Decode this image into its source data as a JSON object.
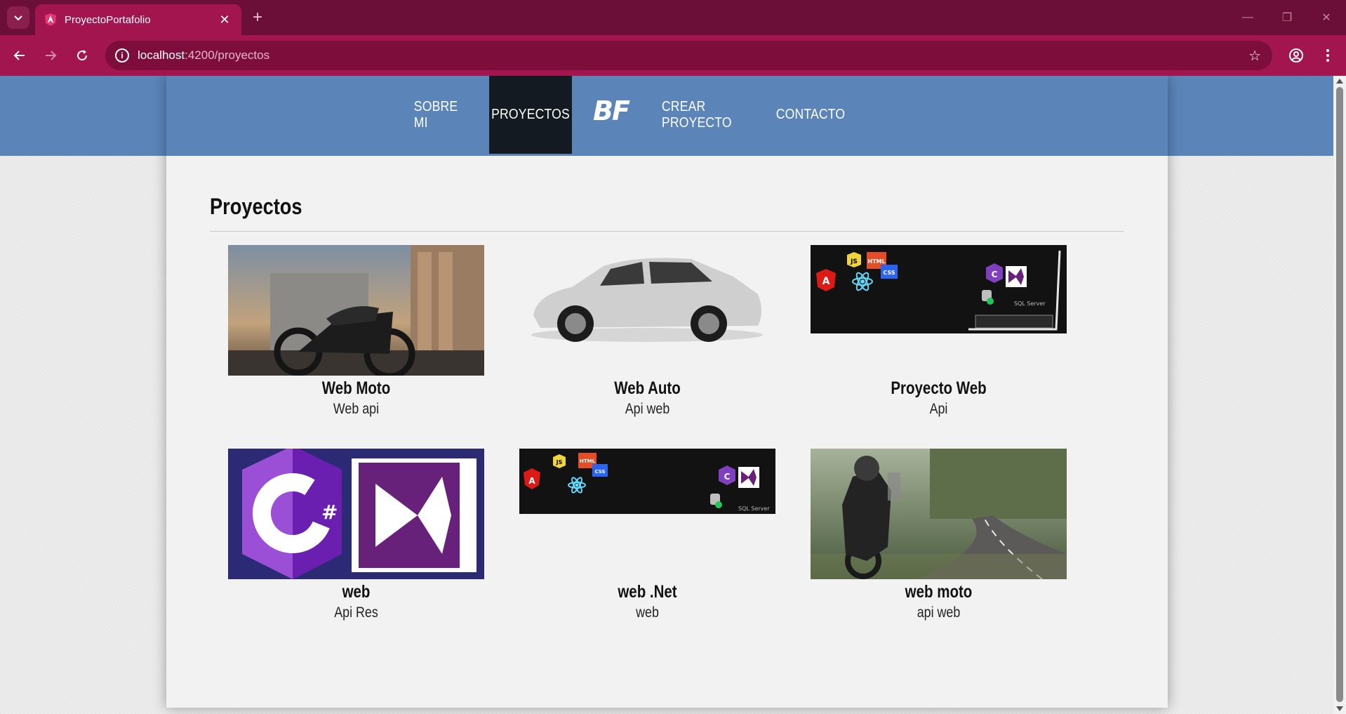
{
  "browser": {
    "tab_title": "ProyectoPortafolio",
    "url_host": "localhost",
    "url_path": ":4200/proyectos"
  },
  "nav": {
    "items": [
      {
        "label": "SOBRE MI",
        "active": false
      },
      {
        "label": "PROYECTOS",
        "active": true
      },
      {
        "label": "CREAR PROYECTO",
        "active": false
      },
      {
        "label": "CONTACTO",
        "active": false
      }
    ],
    "logo_text": "BF"
  },
  "page": {
    "title": "Proyectos"
  },
  "projects": [
    {
      "name": "Web Moto",
      "description": "Web api",
      "image": "motorcycle-photo"
    },
    {
      "name": "Web Auto",
      "description": "Api web",
      "image": "suv-car-photo"
    },
    {
      "name": "Proyecto Web",
      "description": "Api",
      "image": "tech-stack-banner"
    },
    {
      "name": "web",
      "description": "Api Res",
      "image": "csharp-visualstudio-logo"
    },
    {
      "name": "web .Net",
      "description": "web",
      "image": "tech-stack-banner"
    },
    {
      "name": "web moto",
      "description": "api web",
      "image": "adventure-motorcycle-photo"
    }
  ],
  "colors": {
    "tabbar": "#6b0e38",
    "toolbar": "#a3154f",
    "navbar": "#5b85b9",
    "nav_active": "#131a22"
  }
}
